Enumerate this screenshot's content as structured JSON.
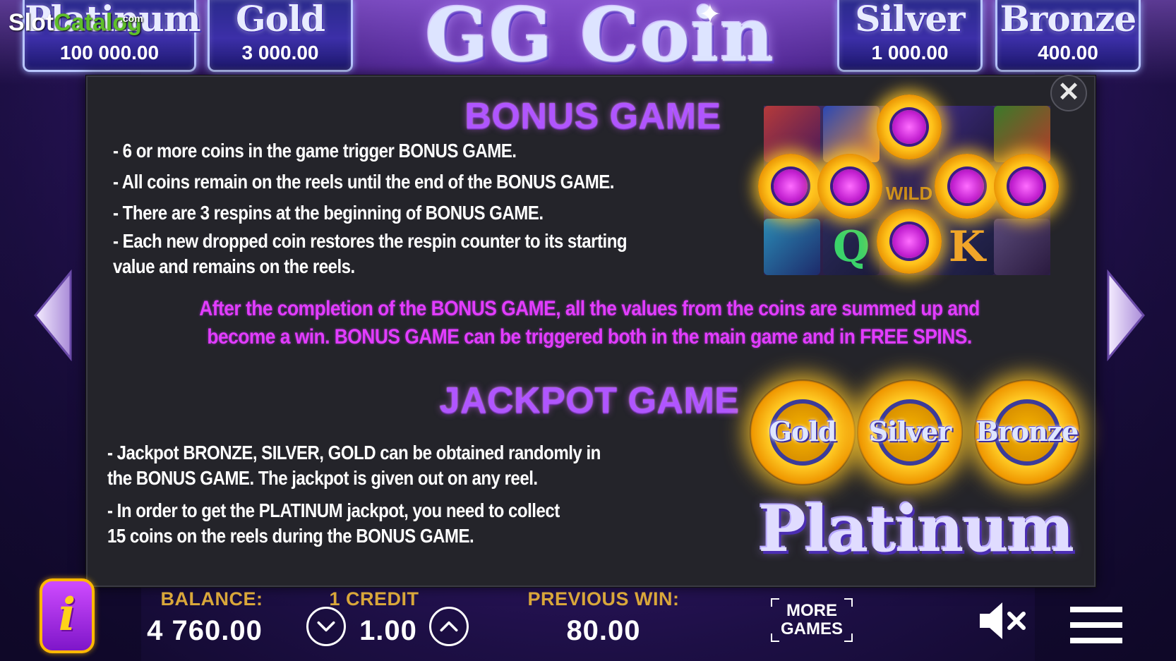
{
  "watermark": {
    "slot": "Slot",
    "catalog": "Catalog",
    "com": ".com"
  },
  "jackpots": [
    {
      "name": "Platinum",
      "value": "100 000.00"
    },
    {
      "name": "Gold",
      "value": "3 000.00"
    },
    {
      "name": "Silver",
      "value": "1 000.00"
    },
    {
      "name": "Bronze",
      "value": "400.00"
    }
  ],
  "logo": {
    "title": "GG Coin"
  },
  "bonus_game": {
    "title": "BONUS GAME",
    "rules": [
      "- 6 or more coins in the game trigger BONUS GAME.",
      "- All coins remain on the reels until the end of the BONUS GAME.",
      "- There are 3 respins at the beginning of BONUS GAME.",
      "- Each new dropped coin restores the respin counter to its starting\nvalue and remains on the reels."
    ],
    "highlight": "After the completion of the BONUS GAME, all the values from the coins are summed up and become a win. BONUS GAME can be triggered both in the main game and in FREE SPINS."
  },
  "jackpot_game": {
    "title": "JACKPOT GAME",
    "rules": [
      "- Jackpot BRONZE, SILVER, GOLD can be obtained randomly in\nthe BONUS GAME. The jackpot is given out on any reel.",
      "- In order to get the PLATINUM jackpot, you need to collect\n15 coins on the reels during the BONUS GAME."
    ],
    "coins": [
      "Gold",
      "Silver",
      "Bronze"
    ],
    "platinum_label": "Platinum"
  },
  "reel_image": {
    "wild_text": "WILD",
    "letter_q": "Q",
    "letter_k": "K"
  },
  "bottom_bar": {
    "info_label": "i",
    "balance_label": "BALANCE:",
    "balance_value": "4 760.00",
    "credit_label": "1 CREDIT",
    "credit_value": "1.00",
    "previous_win_label": "PREVIOUS WIN:",
    "previous_win_value": "80.00",
    "more_games_line1": "MORE",
    "more_games_line2": "GAMES"
  },
  "colors": {
    "accent_purple": "#b055ff",
    "highlight_magenta": "#e33cff",
    "label_gold": "#d9a73a",
    "panel_bg": "#24242a"
  },
  "icons": [
    "close-icon",
    "arrow-left-icon",
    "arrow-right-icon",
    "info-icon",
    "chevron-down-icon",
    "chevron-up-icon",
    "mute-icon",
    "menu-icon"
  ]
}
